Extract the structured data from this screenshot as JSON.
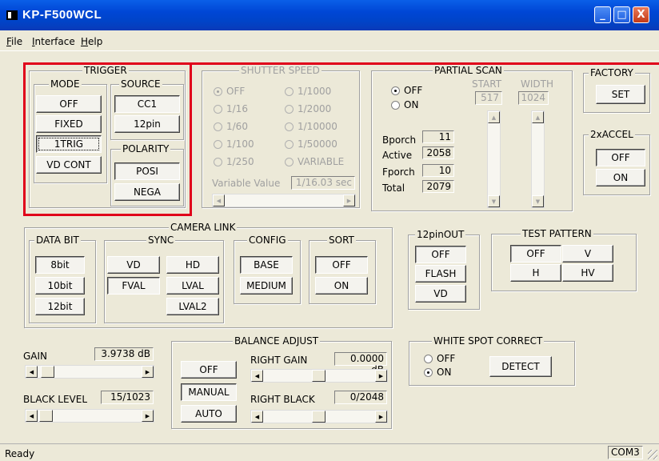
{
  "window": {
    "title": "KP-F500WCL",
    "minimize_glyph": "_",
    "maximize_glyph": "□",
    "close_glyph": "X"
  },
  "menu": [
    {
      "accel": "F",
      "rest": "ile"
    },
    {
      "accel": "I",
      "rest": "nterface"
    },
    {
      "accel": "H",
      "rest": "elp"
    }
  ],
  "trigger": {
    "label": "TRIGGER",
    "mode": {
      "label": "MODE",
      "buttons": [
        "OFF",
        "FIXED",
        "1TRIG",
        "VD CONT"
      ]
    },
    "source": {
      "label": "SOURCE",
      "buttons": [
        "CC1",
        "12pin"
      ]
    },
    "polarity": {
      "label": "POLARITY",
      "buttons": [
        "POSI",
        "NEGA"
      ]
    }
  },
  "shutter": {
    "label": "SHUTTER SPEED",
    "left": [
      "OFF",
      "1/16",
      "1/60",
      "1/100",
      "1/250"
    ],
    "right": [
      "1/1000",
      "1/2000",
      "1/10000",
      "1/50000",
      "VARIABLE"
    ],
    "variable_label": "Variable Value",
    "variable_value": "1/16.03 sec"
  },
  "partial": {
    "label": "PARTIAL SCAN",
    "off": "OFF",
    "on": "ON",
    "start_label": "START",
    "width_label": "WIDTH",
    "start_value": "517",
    "width_value": "1024",
    "rows": [
      {
        "name": "Bporch",
        "value": "11"
      },
      {
        "name": "Active",
        "value": "2058"
      },
      {
        "name": "Fporch",
        "value": "10"
      },
      {
        "name": "Total",
        "value": "2079"
      }
    ]
  },
  "factory": {
    "label": "FACTORY",
    "set": "SET"
  },
  "accel": {
    "label": "2xACCEL",
    "off": "OFF",
    "on": "ON"
  },
  "camlink": {
    "label": "CAMERA LINK",
    "databit": {
      "label": "DATA BIT",
      "buttons": [
        "8bit",
        "10bit",
        "12bit"
      ]
    },
    "sync": {
      "label": "SYNC",
      "buttons": [
        "VD",
        "HD",
        "FVAL",
        "LVAL",
        "LVAL2"
      ]
    },
    "config": {
      "label": "CONFIG",
      "buttons": [
        "BASE",
        "MEDIUM"
      ]
    },
    "sort": {
      "label": "SORT",
      "buttons": [
        "OFF",
        "ON"
      ]
    }
  },
  "pinout": {
    "label": "12pinOUT",
    "buttons": [
      "OFF",
      "FLASH",
      "VD"
    ]
  },
  "testpattern": {
    "label": "TEST PATTERN",
    "buttons": [
      "OFF",
      "V",
      "H",
      "HV"
    ]
  },
  "gain": {
    "label": "GAIN",
    "value": "3.9738 dB",
    "level": 0.03
  },
  "black": {
    "label": "BLACK LEVEL",
    "value": "15/1023",
    "level": 0.015
  },
  "balance": {
    "label": "BALANCE ADJUST",
    "buttons": [
      "OFF",
      "MANUAL",
      "AUTO"
    ],
    "right_gain_label": "RIGHT GAIN",
    "right_gain_value": "0.0000 dB",
    "right_black_label": "RIGHT BLACK",
    "right_black_value": "0/2048"
  },
  "whitespot": {
    "label": "WHITE SPOT CORRECT",
    "off": "OFF",
    "on": "ON",
    "detect": "DETECT"
  },
  "status": {
    "text": "Ready",
    "port": "COM3"
  }
}
